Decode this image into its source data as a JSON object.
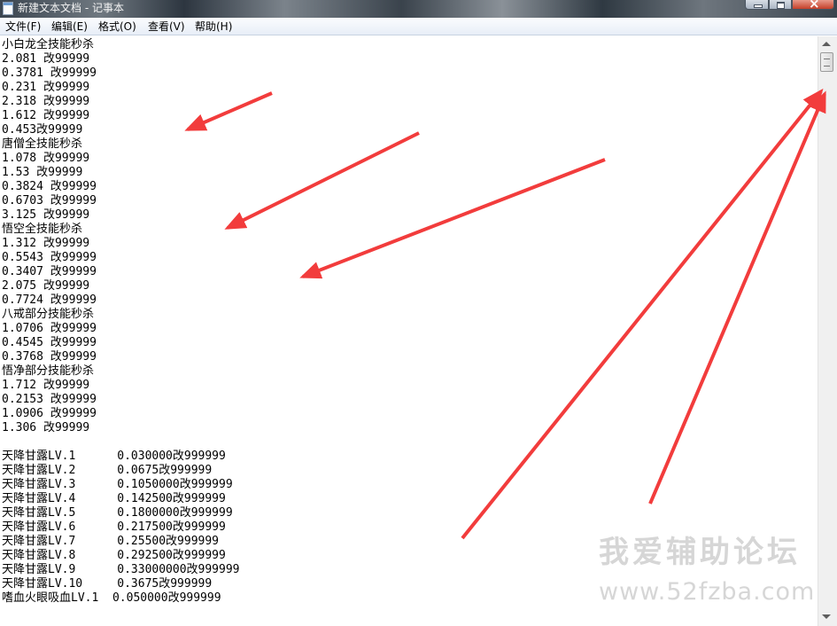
{
  "window": {
    "title": "新建文本文档 - 记事本"
  },
  "menu": [
    "文件(F)",
    "编辑(E)",
    "格式(O)",
    "查看(V)",
    "帮助(H)"
  ],
  "lines": [
    "小白龙全技能秒杀",
    "2.081 改99999",
    "0.3781 改99999",
    "0.231 改99999",
    "2.318 改99999",
    "1.612 改99999",
    "0.453改99999",
    "唐僧全技能秒杀",
    "1.078 改99999",
    "1.53 改99999",
    "0.3824 改99999",
    "0.6703 改99999",
    "3.125 改99999",
    "悟空全技能秒杀",
    "1.312 改99999",
    "0.5543 改99999",
    "0.3407 改99999",
    "2.075 改99999",
    "0.7724 改99999",
    "八戒部分技能秒杀",
    "1.0706 改99999",
    "0.4545 改99999",
    "0.3768 改99999",
    "悟净部分技能秒杀",
    "1.712 改99999",
    "0.2153 改99999",
    "1.0906 改99999",
    "1.306 改99999",
    "",
    "天降甘露LV.1      0.030000改999999",
    "天降甘露LV.2      0.0675改999999",
    "天降甘露LV.3      0.1050000改999999",
    "天降甘露LV.4      0.142500改999999",
    "天降甘露LV.5      0.1800000改999999",
    "天降甘露LV.6      0.217500改999999",
    "天降甘露LV.7      0.25500改999999",
    "天降甘露LV.8      0.292500改999999",
    "天降甘露LV.9      0.33000000改999999",
    "天降甘露LV.10     0.3675改999999",
    "嗜血火眼吸血LV.1  0.050000改999999"
  ],
  "watermark": {
    "name": "我爱辅助论坛",
    "url": "www.52fzba.com"
  },
  "colors": {
    "arrow": "#f23c3c",
    "watermark": "#d6d6d6"
  }
}
